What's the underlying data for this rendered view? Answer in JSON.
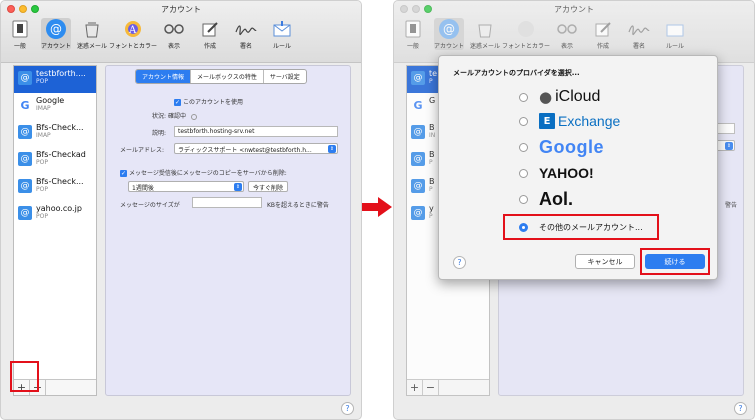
{
  "left_window": {
    "title": "アカウント",
    "toolbar": [
      {
        "label": "一般",
        "icon": "switch-icon"
      },
      {
        "label": "アカウント",
        "icon": "at-icon"
      },
      {
        "label": "迷惑メール",
        "icon": "junk-icon"
      },
      {
        "label": "フォントとカラー",
        "icon": "font-icon"
      },
      {
        "label": "表示",
        "icon": "glasses-icon"
      },
      {
        "label": "作成",
        "icon": "compose-icon"
      },
      {
        "label": "署名",
        "icon": "signature-icon"
      },
      {
        "label": "ルール",
        "icon": "rules-icon"
      }
    ],
    "accounts": [
      {
        "name": "testbforth....",
        "type": "POP"
      },
      {
        "name": "Google",
        "type": "IMAP"
      },
      {
        "name": "Bfs-Check...",
        "type": "IMAP"
      },
      {
        "name": "Bfs-Checkad",
        "type": "POP"
      },
      {
        "name": "Bfs-Check...",
        "type": "POP"
      },
      {
        "name": "yahoo.co.jp",
        "type": "POP"
      }
    ],
    "add_label": "+",
    "remove_label": "−",
    "tabs": [
      "アカウント情報",
      "メールボックスの特性",
      "サーバ設定"
    ],
    "enable_label": "このアカウントを使用",
    "status_label": "状況:",
    "status_value": "確認中",
    "desc_label": "説明:",
    "desc_value": "testbforth.hosting-srv.net",
    "email_label": "メールアドレス:",
    "email_value": "ラディックスサポート <nwtest@testbforth.h...",
    "remove_copy_label": "メッセージ受信後にメッセージのコピーをサーバから削除:",
    "remove_after": "1週間後",
    "remove_now": "今すぐ削除",
    "size_label": "メッセージのサイズが",
    "size_suffix": "KBを超えるときに警告",
    "help": "?"
  },
  "right_window": {
    "title": "アカウント",
    "sidebar_letters": [
      "te",
      "G",
      "B",
      "B",
      "B",
      "y"
    ],
    "sidebar_sub": [
      "P",
      "",
      "IN",
      "P",
      "P",
      "P"
    ],
    "partial_right": [
      "警告"
    ],
    "dialog": {
      "title": "メールアカウントのプロバイダを選択...",
      "providers": [
        {
          "label": "iCloud",
          "selected": false
        },
        {
          "label": "Exchange",
          "selected": false
        },
        {
          "label": "Google",
          "selected": false
        },
        {
          "label": "YAHOO!",
          "selected": false
        },
        {
          "label": "Aol.",
          "selected": false
        },
        {
          "label": "その他のメールアカウント...",
          "selected": true
        }
      ],
      "cancel": "キャンセル",
      "continue": "続ける",
      "help": "?"
    }
  },
  "colors": {
    "accent": "#2d7df0",
    "highlight": "#e3101a",
    "panel": "#e6e6f7"
  }
}
